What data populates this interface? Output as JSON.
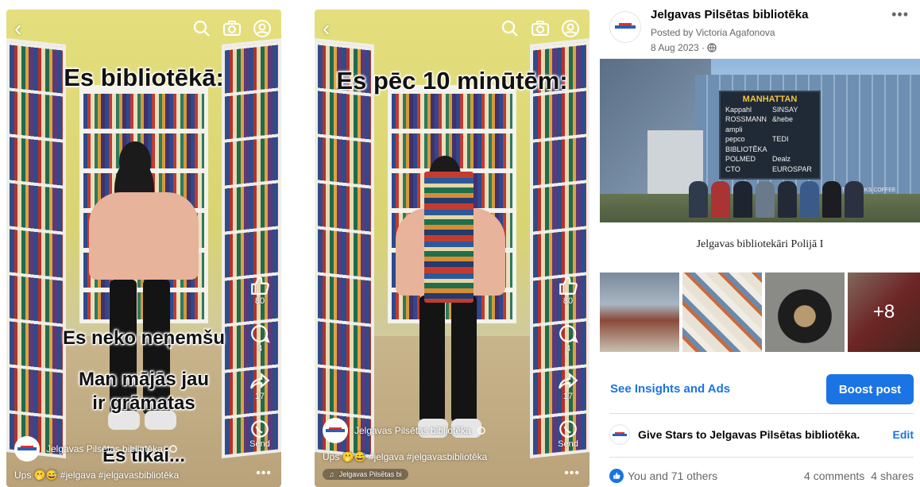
{
  "reel1": {
    "overlay_top": "Es bibliotēkā:",
    "overlay_line1": "Es neko neņemšu",
    "overlay_line2": "Man mājās jau",
    "overlay_line3": "ir grāmatas",
    "overlay_line4": "Es tikai...",
    "account_name": "Jelgavas Pilsētas bibliotēka",
    "caption": "Ups 🫢😅 #jelgava #jelgavasbibliotēka",
    "like_count": "80",
    "comment_count": "4",
    "share_count": "17",
    "send_label": "Send"
  },
  "reel2": {
    "overlay_top": "Es pēc 10 minūtēm:",
    "account_name": "Jelgavas Pilsētas bibliotēka",
    "caption": "Ups 🫢😅 #jelgava #jelgavasbibliotēka",
    "like_count": "80",
    "comment_count": "4",
    "share_count": "17",
    "send_label": "Send",
    "music_label": "Jelgavas Pilsētas bi"
  },
  "fb": {
    "page_name": "Jelgavas Pilsētas bibliotēka",
    "posted_by": "Posted by Victoria Agafonova",
    "date": "8 Aug 2023 ·",
    "sign_header": "MANHATTAN",
    "sign_left": [
      "Kappahl",
      "ROSSMANN",
      "ampli",
      "pepco",
      "BIBLIOTĒKA",
      "POLMED",
      "CTO"
    ],
    "sign_right": [
      "SINSAY",
      "&hebe",
      "",
      "TEDI",
      "",
      "Dealz",
      "EUROSPAR"
    ],
    "starbucks": "STARBUCKS COFFEE",
    "album_title": "Jelgavas bibliotekāri Polijā I",
    "more_photos": "+8",
    "insights_link": "See Insights and Ads",
    "boost_button": "Boost post",
    "stars_text": "Give Stars to Jelgavas Pilsētas bibliotēka.",
    "stars_edit": "Edit",
    "likes_text": "You and 71 others",
    "comments_text": "4 comments",
    "shares_text": "4 shares"
  },
  "colors": {
    "fb_blue": "#1b74e4",
    "wall_yellow": "#e4df7c"
  }
}
